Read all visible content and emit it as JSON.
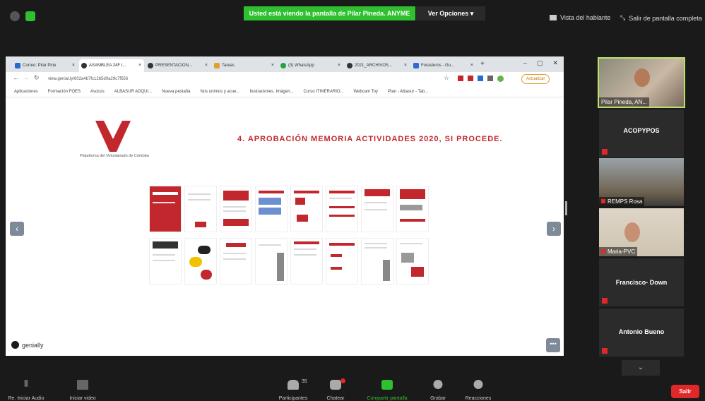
{
  "topbar": {
    "share_banner": "Usted está viendo la pantalla de Pilar Pineda. ANYME",
    "options_label": "Ver Opciones",
    "speaker_view_label": "Vista del hablante",
    "exit_fullscreen_label": "Salir de pantalla completa"
  },
  "browser": {
    "tabs": [
      {
        "label": "Correo: Pilar Pine"
      },
      {
        "label": "ASAMBLEA 24F I..."
      },
      {
        "label": "PRESENTACION..."
      },
      {
        "label": "Tareas"
      },
      {
        "label": "(3) WhatsApp"
      },
      {
        "label": "2021_ARCHIVOS..."
      },
      {
        "label": "Forasteros - Go..."
      }
    ],
    "url": "view.genial.ly/602a4b7fc12b5d0a29c7f556",
    "bookmarks": [
      "Aplicaciones",
      "Formación FOES",
      "Asocos",
      "ALBASUR ADQUI...",
      "Nueva pestaña",
      "Nos unimos y acue...",
      "Ilustraciones. Imágen...",
      "Curso ITINERARIO...",
      "Webcam Toy",
      "Plan - Albasur - Tab..."
    ],
    "update_label": "Actualizar"
  },
  "slide": {
    "org_name": "Plataforma del Voluntariado de Córdoba",
    "title": "4. APROBACIÓN MEMORIA ACTIVIDADES 2020, SI PROCEDE.",
    "genially_label": "genially",
    "more_label": "•••"
  },
  "participants": [
    {
      "name": "Pilar Pineda, AN...",
      "type": "video"
    },
    {
      "name": "ACOPYPOS",
      "type": "name"
    },
    {
      "name": "REMPS Rosa",
      "type": "video"
    },
    {
      "name": "Maria-PVC",
      "type": "video"
    },
    {
      "name": "Francisco- Down",
      "type": "name"
    },
    {
      "name": "Antonio Bueno",
      "type": "name"
    }
  ],
  "toolbar": {
    "audio_label": "Re. Iniciar Audio",
    "video_label": "Iniciar video",
    "participants_label": "Participantes",
    "participants_count": "35",
    "chat_label": "Chatear",
    "share_label": "Compartir pantalla",
    "record_label": "Grabar",
    "reactions_label": "Reacciones",
    "leave_label": "Salir"
  },
  "colors": {
    "accent_red": "#c2272d",
    "share_green": "#2fc02f",
    "leave_red": "#e02828"
  }
}
